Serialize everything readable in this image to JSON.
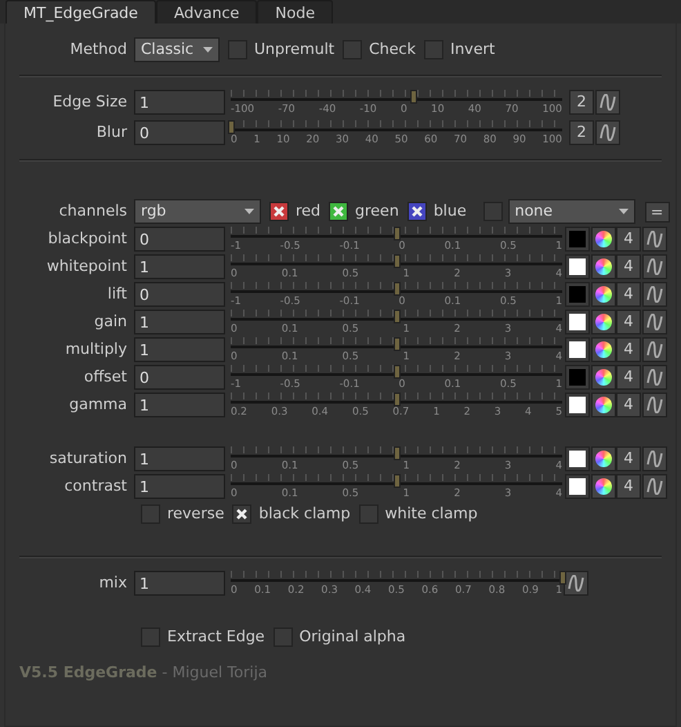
{
  "tabs": [
    {
      "label": "MT_EdgeGrade",
      "selected": true
    },
    {
      "label": "Advance",
      "selected": false
    },
    {
      "label": "Node",
      "selected": false
    }
  ],
  "method": {
    "label": "Method",
    "value": "Classic",
    "options": [
      {
        "label": "Unpremult",
        "checked": false
      },
      {
        "label": "Check",
        "checked": false
      },
      {
        "label": "Invert",
        "checked": false
      }
    ]
  },
  "edge_controls": [
    {
      "label": "Edge Size",
      "value": "1",
      "level": 0.55,
      "ticks": [
        "-100",
        "-70",
        "-40",
        "-10",
        "0",
        "10",
        "40",
        "70",
        "100"
      ],
      "count": "2"
    },
    {
      "label": "Blur",
      "value": "0",
      "level": 0,
      "ticks": [
        "0",
        "1",
        "10",
        "20",
        "30",
        "40",
        "50",
        "60",
        "70",
        "80",
        "90",
        "100"
      ],
      "count": "2"
    }
  ],
  "channels": {
    "label": "channels",
    "value": "rgb",
    "checks": [
      {
        "label": "red",
        "checked": true,
        "color": "#c8393c"
      },
      {
        "label": "green",
        "checked": true,
        "color": "#3fb83f"
      },
      {
        "label": "blue",
        "checked": true,
        "color": "#4545c0"
      }
    ],
    "extra_checked": false,
    "layer": "none",
    "button": "="
  },
  "grade_rows": [
    {
      "label": "blackpoint",
      "value": "0",
      "level": 0.5,
      "ticks": [
        "-1",
        "-0.5",
        "-0.1",
        "0",
        "0.1",
        "0.5",
        "1"
      ],
      "color": "#000000",
      "count": "4"
    },
    {
      "label": "whitepoint",
      "value": "1",
      "level": 0.5,
      "ticks": [
        "0",
        "0.1",
        "0.5",
        "1",
        "2",
        "3",
        "4"
      ],
      "color": "#ffffff",
      "count": "4"
    },
    {
      "label": "lift",
      "value": "0",
      "level": 0.5,
      "ticks": [
        "-1",
        "-0.5",
        "-0.1",
        "0",
        "0.1",
        "0.5",
        "1"
      ],
      "color": "#000000",
      "count": "4"
    },
    {
      "label": "gain",
      "value": "1",
      "level": 0.5,
      "ticks": [
        "0",
        "0.1",
        "0.5",
        "1",
        "2",
        "3",
        "4"
      ],
      "color": "#ffffff",
      "count": "4"
    },
    {
      "label": "multiply",
      "value": "1",
      "level": 0.5,
      "ticks": [
        "0",
        "0.1",
        "0.5",
        "1",
        "2",
        "3",
        "4"
      ],
      "color": "#ffffff",
      "count": "4"
    },
    {
      "label": "offset",
      "value": "0",
      "level": 0.5,
      "ticks": [
        "-1",
        "-0.5",
        "-0.1",
        "0",
        "0.1",
        "0.5",
        "1"
      ],
      "color": "#000000",
      "count": "4"
    },
    {
      "label": "gamma",
      "value": "1",
      "level": 0.5,
      "ticks": [
        "0.2",
        "0.3",
        "0.4",
        "0.5",
        "0.7",
        "1",
        "2",
        "3",
        "4",
        "5"
      ],
      "color": "#ffffff",
      "count": "4"
    }
  ],
  "color_rows": [
    {
      "label": "saturation",
      "value": "1",
      "level": 0.5,
      "ticks": [
        "0",
        "0.1",
        "0.5",
        "1",
        "2",
        "3",
        "4"
      ],
      "color": "#ffffff",
      "count": "4"
    },
    {
      "label": "contrast",
      "value": "1",
      "level": 0.5,
      "ticks": [
        "0",
        "0.1",
        "0.5",
        "1",
        "2",
        "3",
        "4"
      ],
      "color": "#ffffff",
      "count": "4"
    }
  ],
  "clamp_options": [
    {
      "label": "reverse",
      "checked": false
    },
    {
      "label": "black clamp",
      "checked": true
    },
    {
      "label": "white clamp",
      "checked": false
    }
  ],
  "mix": {
    "label": "mix",
    "value": "1",
    "level": 1,
    "ticks": [
      "0",
      "0.1",
      "0.2",
      "0.3",
      "0.4",
      "0.5",
      "0.6",
      "0.7",
      "0.8",
      "0.9",
      "1"
    ]
  },
  "output_options": [
    {
      "label": "Extract Edge",
      "checked": false
    },
    {
      "label": "Original alpha",
      "checked": false
    }
  ],
  "footer": "**V5.5 EdgeGrade** - Miguel Torija"
}
